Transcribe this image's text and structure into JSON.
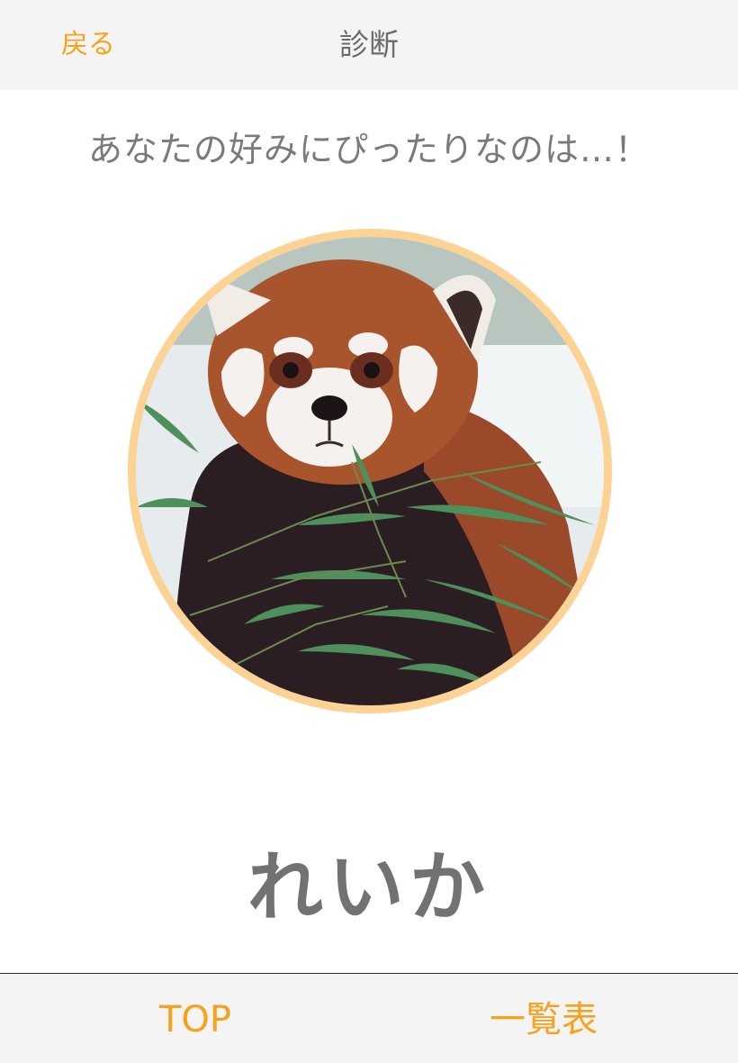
{
  "header": {
    "back_label": "戻る",
    "title": "診断"
  },
  "result": {
    "heading": "あなたの好みにぴったりなのは…！",
    "name": "れいか"
  },
  "tab_bar": {
    "top_label": "TOP",
    "list_label": "一覧表"
  },
  "colors": {
    "accent": "#f7a11c",
    "frame": "#fcd295",
    "text_gray": "#727272"
  }
}
